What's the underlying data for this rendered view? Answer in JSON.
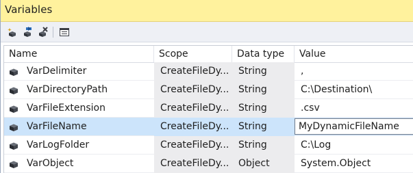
{
  "window": {
    "title": "Variables"
  },
  "toolbar": {
    "buttons": [
      {
        "name": "add-variable-button",
        "icon": "add-variable-icon"
      },
      {
        "name": "move-variable-button",
        "icon": "move-variable-icon"
      },
      {
        "name": "delete-variable-button",
        "icon": "delete-variable-icon"
      },
      {
        "name": "grid-options-button",
        "icon": "grid-options-icon"
      }
    ]
  },
  "grid": {
    "columns": [
      "Name",
      "Scope",
      "Data type",
      "Value"
    ],
    "rows": [
      {
        "name": "VarDelimiter",
        "scope": "CreateFileDy...",
        "type": "String",
        "value": ","
      },
      {
        "name": "VarDirectoryPath",
        "scope": "CreateFileDy...",
        "type": "String",
        "value": "C:\\Destination\\"
      },
      {
        "name": "VarFileExtension",
        "scope": "CreateFileDy...",
        "type": "String",
        "value": ".csv"
      },
      {
        "name": "VarFileName",
        "scope": "CreateFileDy...",
        "type": "String",
        "value": "MyDynamicFileName",
        "selected": true
      },
      {
        "name": "VarLogFolder",
        "scope": "CreateFileDy...",
        "type": "String",
        "value": "C:\\Log"
      },
      {
        "name": "VarObject",
        "scope": "CreateFileDy...",
        "type": "Object",
        "value": "System.Object"
      }
    ]
  },
  "colors": {
    "title_bar": "#fff29d",
    "selected_row": "#cce4fb",
    "readonly_cell": "#ececee"
  }
}
